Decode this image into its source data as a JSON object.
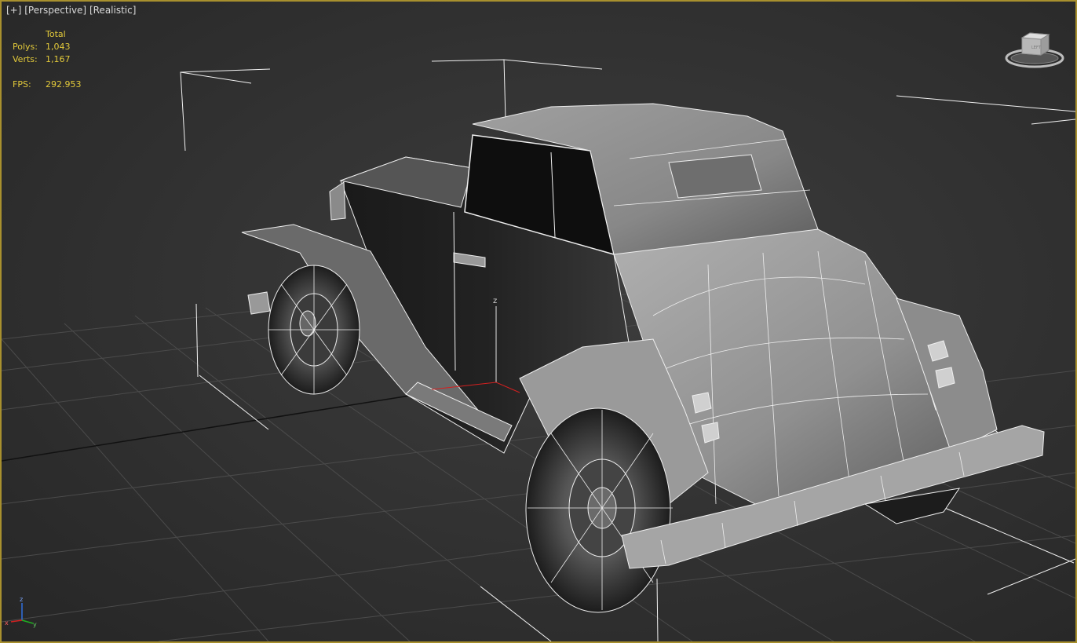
{
  "viewport": {
    "label_plus": "[+]",
    "label_view": "[Perspective]",
    "label_shading": "[Realistic]"
  },
  "stats": {
    "header": "Total",
    "polys_label": "Polys:",
    "polys_value": "1,043",
    "verts_label": "Verts:",
    "verts_value": "1,167",
    "fps_label": "FPS:",
    "fps_value": "292.953"
  },
  "viewcube": {
    "icon": "viewcube-icon",
    "face_label": "LEFT"
  },
  "pivot_gizmo": {
    "axis_label": "z"
  },
  "tripod": {
    "z": "z",
    "x": "x",
    "y": "y"
  },
  "colors": {
    "frame_border": "#a8902e",
    "stats_text": "#e2c93a",
    "wireframe": "#ffffff",
    "axis_x": "#d42020",
    "axis_y": "#20b020",
    "axis_z": "#3070e0"
  }
}
